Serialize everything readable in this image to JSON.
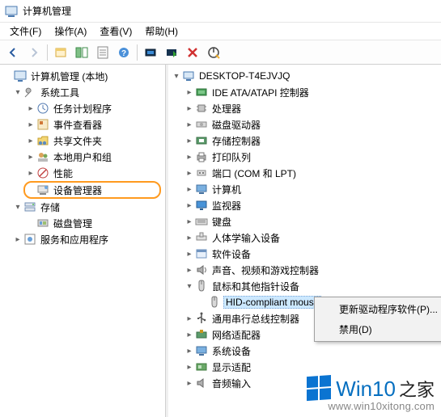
{
  "window": {
    "title": "计算机管理"
  },
  "menu": {
    "file": "文件(F)",
    "action": "操作(A)",
    "view": "查看(V)",
    "help": "帮助(H)"
  },
  "left_tree": {
    "root": "计算机管理 (本地)",
    "system_tools": "系统工具",
    "task_scheduler": "任务计划程序",
    "event_viewer": "事件查看器",
    "shared_folders": "共享文件夹",
    "local_users": "本地用户和组",
    "performance": "性能",
    "device_manager": "设备管理器",
    "storage": "存储",
    "disk_management": "磁盘管理",
    "services_apps": "服务和应用程序"
  },
  "right_tree": {
    "root": "DESKTOP-T4EJVJQ",
    "ide": "IDE ATA/ATAPI 控制器",
    "cpu": "处理器",
    "disk": "磁盘驱动器",
    "storage_ctrl": "存储控制器",
    "print_queue": "打印队列",
    "ports": "端口 (COM 和 LPT)",
    "computer": "计算机",
    "monitor": "监视器",
    "keyboard": "键盘",
    "hid": "人体学输入设备",
    "software_dev": "软件设备",
    "sound": "声音、视频和游戏控制器",
    "mouse_cat": "鼠标和其他指针设备",
    "hid_mouse": "HID-compliant mouse",
    "usb": "通用串行总线控制器",
    "network": "网络适配器",
    "system_dev": "系统设备",
    "display": "显示适配",
    "audio_in": "音频输入"
  },
  "context": {
    "update_driver": "更新驱动程序软件(P)...",
    "disable": "禁用(D)"
  },
  "watermark": {
    "brand1": "Win10",
    "brand2": "之家",
    "url": "www.win10xitong.com"
  }
}
